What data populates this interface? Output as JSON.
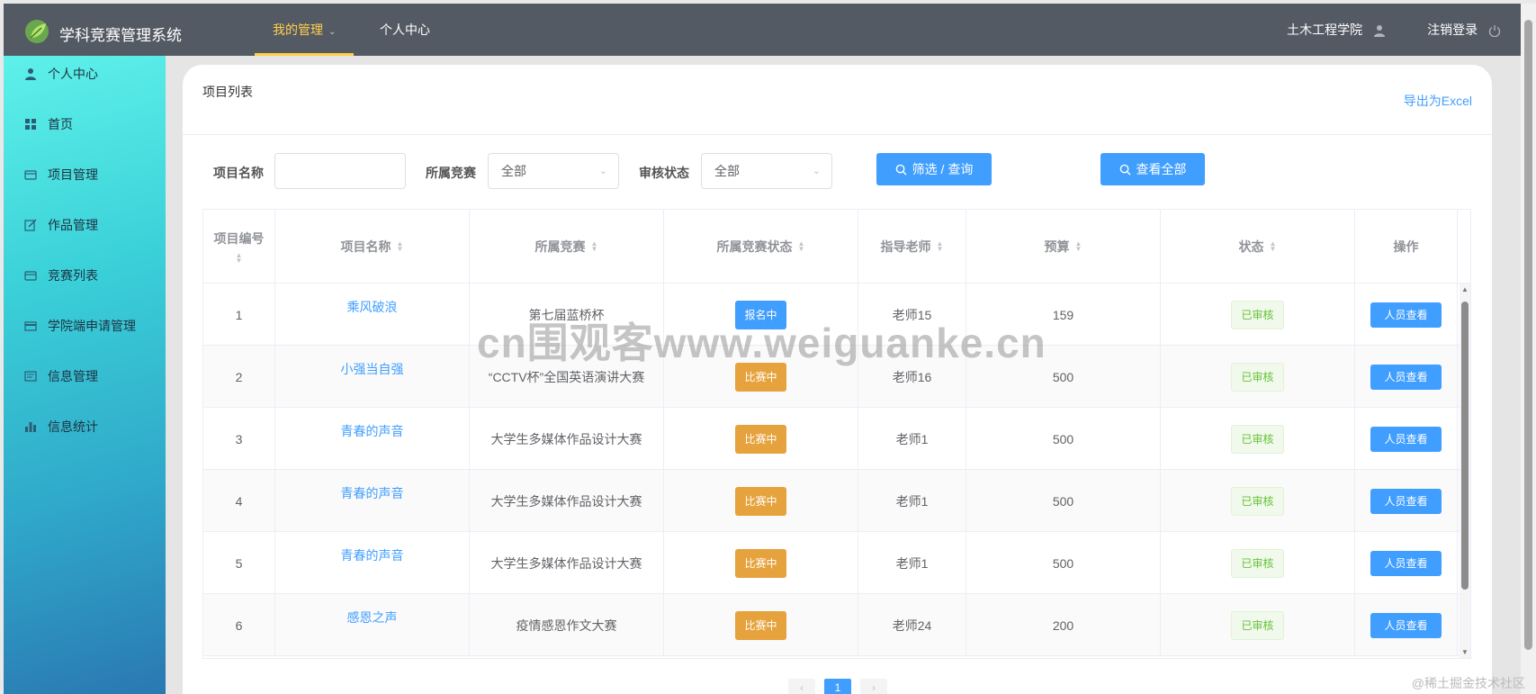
{
  "app": {
    "title": "学科竞赛管理系统",
    "accent": "#ffd04b",
    "primary": "#409eff"
  },
  "topnav": {
    "items": [
      {
        "label": "我的管理",
        "active": true,
        "has_caret": true
      },
      {
        "label": "个人中心",
        "active": false,
        "has_caret": false
      }
    ],
    "user": "土木工程学院",
    "logout": "注销登录"
  },
  "sidebar": {
    "items": [
      {
        "label": "个人中心",
        "icon": "user-icon"
      },
      {
        "label": "首页",
        "icon": "grid-icon"
      },
      {
        "label": "项目管理",
        "icon": "folder-icon"
      },
      {
        "label": "作品管理",
        "icon": "edit-icon"
      },
      {
        "label": "竞赛列表",
        "icon": "folder-icon"
      },
      {
        "label": "学院端申请管理",
        "icon": "card-icon"
      },
      {
        "label": "信息管理",
        "icon": "doc-icon"
      },
      {
        "label": "信息统计",
        "icon": "chart-icon"
      }
    ]
  },
  "card": {
    "title": "项目列表",
    "export": "导出为Excel"
  },
  "filters": {
    "name_label": "项目名称",
    "name_value": "",
    "competition_label": "所属竞赛",
    "competition_value": "全部",
    "status_label": "审核状态",
    "status_value": "全部",
    "search_button": "筛选 / 查询",
    "view_all_button": "查看全部"
  },
  "table": {
    "columns": [
      "项目编号",
      "项目名称",
      "所属竞赛",
      "所属竞赛状态",
      "指导老师",
      "预算",
      "状态",
      "操作"
    ],
    "rows": [
      {
        "id": "1",
        "name": "乘风破浪",
        "competition": "第七届蓝桥杯",
        "comp_status": "报名中",
        "comp_status_color": "blue",
        "teacher": "老师15",
        "budget": "159",
        "status": "已审核",
        "action": "人员查看"
      },
      {
        "id": "2",
        "name": "小强当自强",
        "competition": "“CCTV杯”全国英语演讲大赛",
        "comp_status": "比赛中",
        "comp_status_color": "orange",
        "teacher": "老师16",
        "budget": "500",
        "status": "已审核",
        "action": "人员查看"
      },
      {
        "id": "3",
        "name": "青春的声音",
        "competition": "大学生多媒体作品设计大赛",
        "comp_status": "比赛中",
        "comp_status_color": "orange",
        "teacher": "老师1",
        "budget": "500",
        "status": "已审核",
        "action": "人员查看"
      },
      {
        "id": "4",
        "name": "青春的声音",
        "competition": "大学生多媒体作品设计大赛",
        "comp_status": "比赛中",
        "comp_status_color": "orange",
        "teacher": "老师1",
        "budget": "500",
        "status": "已审核",
        "action": "人员查看"
      },
      {
        "id": "5",
        "name": "青春的声音",
        "competition": "大学生多媒体作品设计大赛",
        "comp_status": "比赛中",
        "comp_status_color": "orange",
        "teacher": "老师1",
        "budget": "500",
        "status": "已审核",
        "action": "人员查看"
      },
      {
        "id": "6",
        "name": "感恩之声",
        "competition": "疫情感恩作文大赛",
        "comp_status": "比赛中",
        "comp_status_color": "orange",
        "teacher": "老师24",
        "budget": "200",
        "status": "已审核",
        "action": "人员查看"
      }
    ]
  },
  "pagination": {
    "prev": "‹",
    "current": "1",
    "next": "›"
  },
  "watermark": "cn围观客www.weiguanke.cn",
  "credit": "@稀土掘金技术社区"
}
